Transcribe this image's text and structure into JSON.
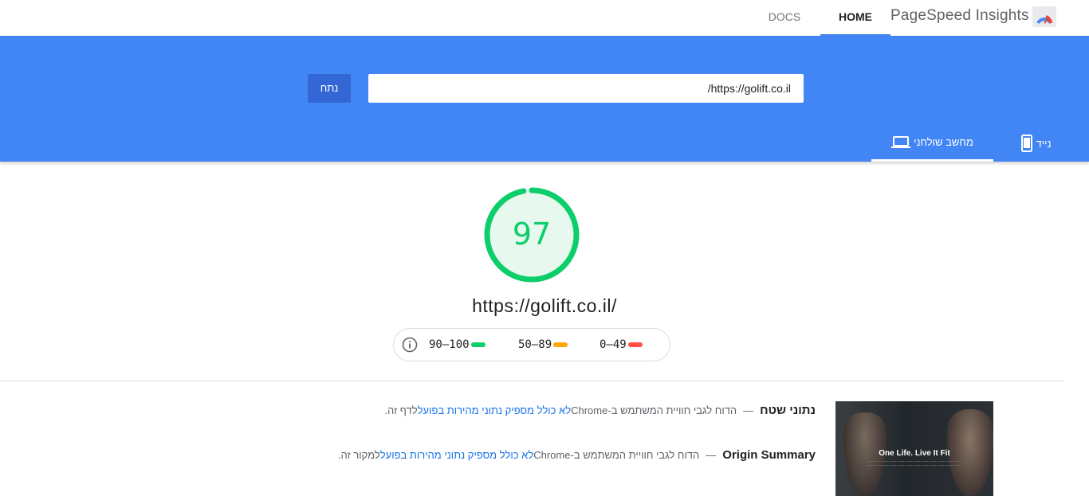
{
  "header": {
    "app_title": "PageSpeed Insights",
    "nav": {
      "home": "HOME",
      "docs": "DOCS"
    }
  },
  "search": {
    "url_value": "https://golift.co.il/",
    "analyze_label": "נתח"
  },
  "tabs": {
    "desktop": "מחשב שולחני",
    "mobile": "נייד",
    "active": "desktop"
  },
  "score": {
    "value": "97",
    "fraction": 0.97,
    "url": "https://golift.co.il/",
    "color": "#0cce6b"
  },
  "legend": {
    "good": {
      "range": "90–100",
      "color": "#0cce6b"
    },
    "average": {
      "range": "50–89",
      "color": "#ffa400"
    },
    "poor": {
      "range": "0–49",
      "color": "#ff4e42"
    }
  },
  "field_data": {
    "title": "נתוני שטח",
    "dash": "—",
    "text_before": "הדוח לגבי חוויית המשתמש ב-Chrome ",
    "link": "לא כולל מספיק נתוני מהירות בפועל",
    "text_after": " לדף זה."
  },
  "origin_summary": {
    "title": "Origin Summary",
    "dash": "—",
    "text_before": "הדוח לגבי חוויית המשתמש ב-Chrome ",
    "link": "לא כולל מספיק נתוני מהירות בפועל",
    "text_after": " למקור זה."
  },
  "screenshot": {
    "headline": "One Life. Live It Fit"
  }
}
